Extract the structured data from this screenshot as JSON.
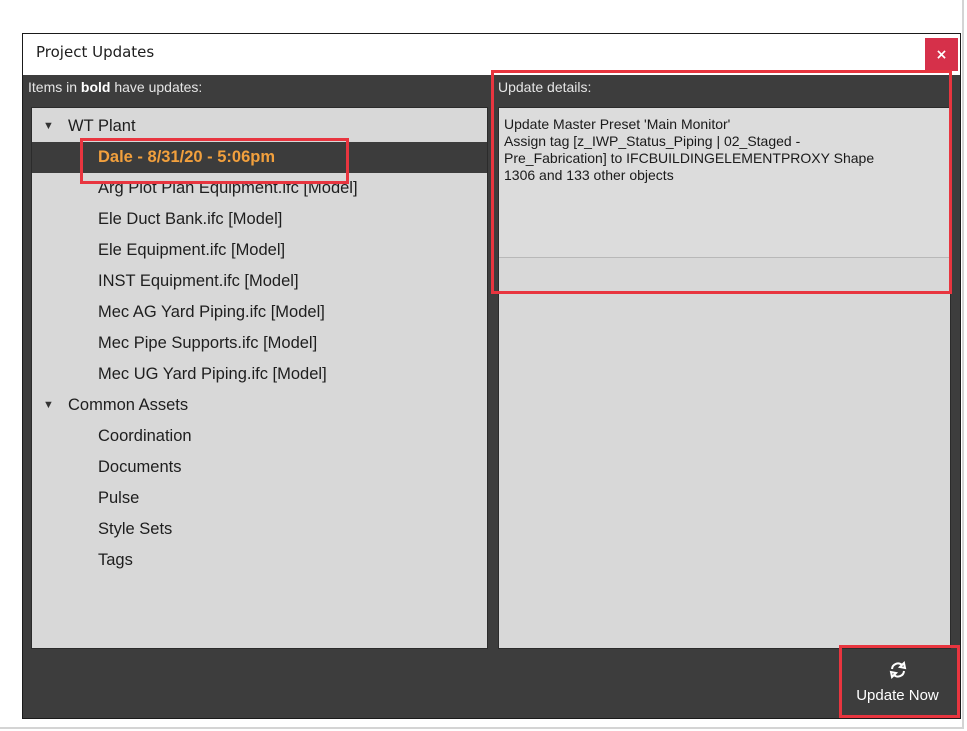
{
  "dialog": {
    "title": "Project Updates",
    "close_label": "×"
  },
  "left_header": {
    "prefix": "Items in ",
    "bold": "bold",
    "suffix": " have updates:"
  },
  "right_header": "Update details:",
  "tree": {
    "items": [
      {
        "label": "WT Plant",
        "level": 0,
        "expanded": true
      },
      {
        "label": "Dale - 8/31/20 - 5:06pm",
        "level": 1,
        "selected": true
      },
      {
        "label": "Arg Plot Plan Equipment.ifc [Model]",
        "level": 1
      },
      {
        "label": "Ele Duct Bank.ifc [Model]",
        "level": 1
      },
      {
        "label": "Ele Equipment.ifc [Model]",
        "level": 1
      },
      {
        "label": "INST Equipment.ifc [Model]",
        "level": 1
      },
      {
        "label": "Mec AG Yard Piping.ifc [Model]",
        "level": 1
      },
      {
        "label": "Mec Pipe Supports.ifc [Model]",
        "level": 1
      },
      {
        "label": "Mec UG Yard Piping.ifc [Model]",
        "level": 1
      },
      {
        "label": "Common Assets",
        "level": 0,
        "expanded": true
      },
      {
        "label": "Coordination",
        "level": 1
      },
      {
        "label": "Documents",
        "level": 1
      },
      {
        "label": "Pulse",
        "level": 1
      },
      {
        "label": "Style Sets",
        "level": 1
      },
      {
        "label": "Tags",
        "level": 1
      }
    ]
  },
  "details": {
    "lines": [
      "Update Master Preset 'Main Monitor'",
      "Assign tag [z_IWP_Status_Piping | 02_Staged -",
      "Pre_Fabrication] to IFCBUILDINGELEMENTPROXY Shape",
      "1306 and 133 other objects"
    ]
  },
  "update_button": {
    "icon": "sync-icon",
    "label": "Update Now"
  },
  "colors": {
    "dialog_bg": "#3d3d3d",
    "panel_bg": "#d8d8d8",
    "selected_text": "#f2a03d",
    "highlight": "#e8353f",
    "close_bg": "#d6304a"
  }
}
